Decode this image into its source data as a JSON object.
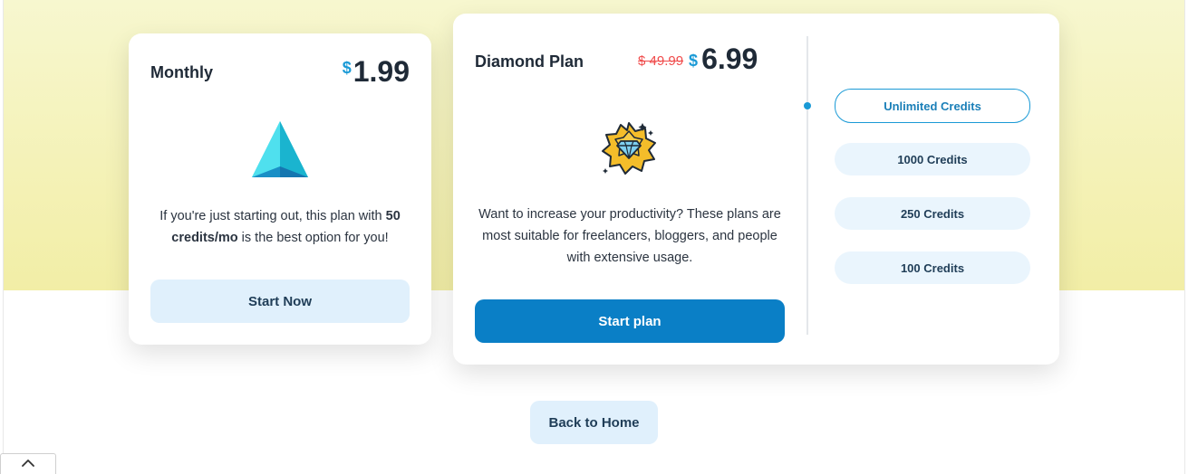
{
  "monthly": {
    "title": "Monthly",
    "currency": "$",
    "price": "1.99",
    "desc_prefix": "If you're just starting out, this plan with ",
    "desc_bold": "50 credits/mo",
    "desc_suffix": " is the best option for you!",
    "button": "Start Now",
    "icon": "pyramid-icon"
  },
  "diamond": {
    "title": "Diamond Plan",
    "old_price": "$ 49.99",
    "currency": "$",
    "price": "6.99",
    "description": "Want to increase your productivity? These plans are most suitable for freelancers, bloggers, and people with extensive usage.",
    "button": "Start plan",
    "icon": "diamond-badge-icon",
    "credit_options": [
      {
        "label": "Unlimited Credits",
        "selected": true
      },
      {
        "label": "1000 Credits",
        "selected": false
      },
      {
        "label": "250 Credits",
        "selected": false
      },
      {
        "label": "100 Credits",
        "selected": false
      }
    ]
  },
  "back_button": "Back to Home",
  "scroll_icon": "chevron-up-icon",
  "colors": {
    "accent": "#1a9ad6",
    "primary_button": "#0a7fc6",
    "soft_button": "#e0f0fc",
    "old_price": "#f04b4b",
    "hero_bg": "#f2eea6"
  }
}
